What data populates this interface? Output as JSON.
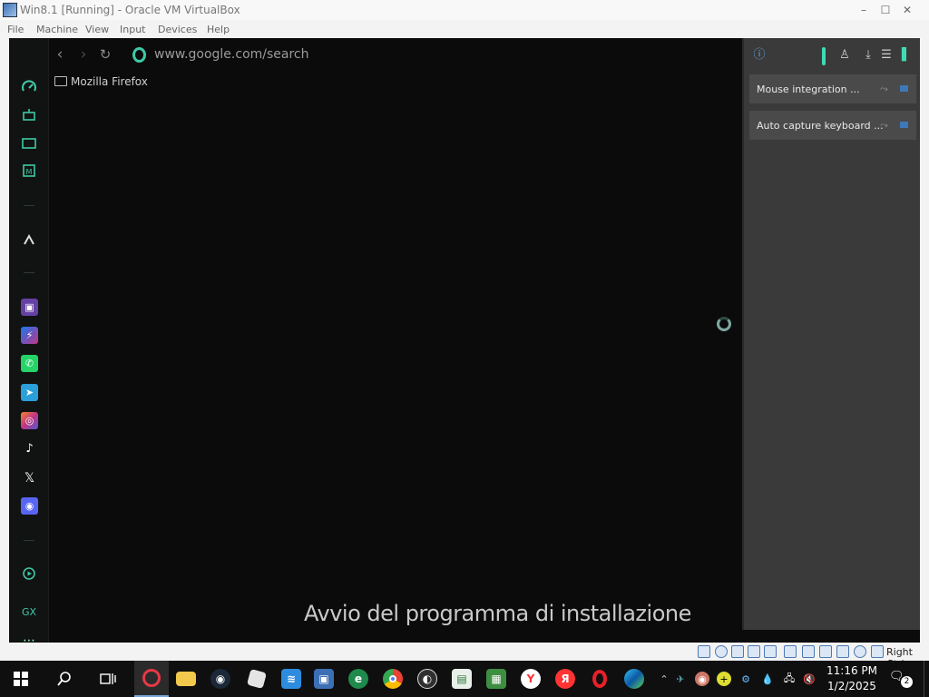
{
  "vbox": {
    "title": "Win8.1 [Running] - Oracle VM VirtualBox",
    "menu": [
      "File",
      "Machine",
      "View",
      "Input",
      "Devices",
      "Help"
    ],
    "host_key": "Right Ctrl"
  },
  "browser": {
    "url": "www.google.com/search",
    "bookmark_folder": "Mozilla Firefox"
  },
  "panel": {
    "notices": [
      {
        "text": "Mouse integration ..."
      },
      {
        "text": "Auto capture keyboard ..."
      }
    ]
  },
  "installer": {
    "caption": "Avvio del programma di installazione"
  },
  "taskbar": {
    "time": "11:16 PM",
    "date": "1/2/2025",
    "notification_count": "2"
  },
  "colors": {
    "opera_accent": "#3fc9a6",
    "taskbar_bg": "#0f0f0f"
  }
}
